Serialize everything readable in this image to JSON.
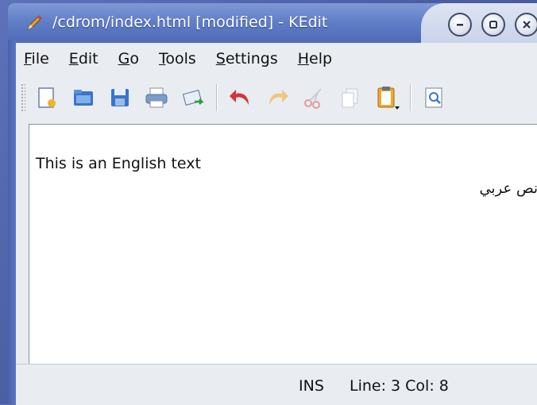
{
  "window": {
    "title": "/cdrom/index.html [modified] - KEdit"
  },
  "menu": [
    "File",
    "Edit",
    "Go",
    "Tools",
    "Settings",
    "Help"
  ],
  "toolbar": {
    "icons": [
      "new-file-icon",
      "open-folder-icon",
      "save-icon",
      "print-icon",
      "mail-icon",
      "undo-icon",
      "redo-icon",
      "cut-icon",
      "copy-icon",
      "paste-icon",
      "find-icon"
    ]
  },
  "editor": {
    "line1": "This is an English text",
    "line2": "نص عربي"
  },
  "status": {
    "mode": "INS",
    "position": "Line: 3 Col: 8"
  },
  "colors": {
    "titlebar": "#5f7cc6",
    "panel": "#e9ecf1",
    "desktop": "#4a5ea4"
  }
}
